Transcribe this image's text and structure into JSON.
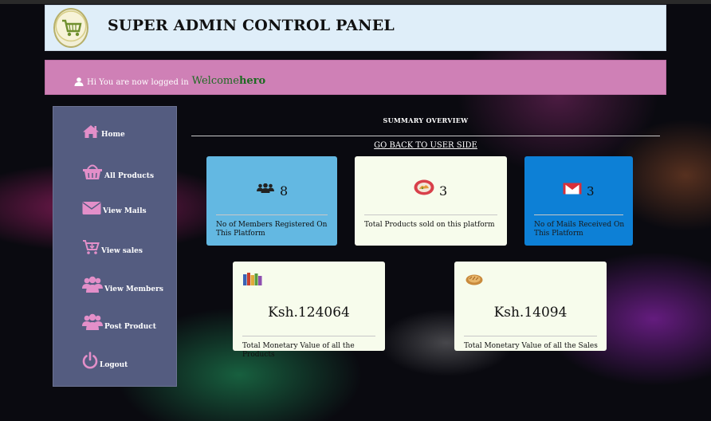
{
  "header": {
    "title": "SUPER ADMIN CONTROL PANEL"
  },
  "welcome": {
    "prefix": "Hi You are now logged in",
    "greeting": "Welcome",
    "username": "hero"
  },
  "sidebar": {
    "items": [
      {
        "label": "Home",
        "icon": "home-icon"
      },
      {
        "label": "All Products",
        "icon": "basket-icon"
      },
      {
        "label": "View Mails",
        "icon": "envelope-icon"
      },
      {
        "label": "View sales",
        "icon": "cart-icon"
      },
      {
        "label": "View Members",
        "icon": "users-icon"
      },
      {
        "label": "Post Product",
        "icon": "users-icon"
      },
      {
        "label": "Logout",
        "icon": "power-icon"
      }
    ]
  },
  "main": {
    "heading": "SUMMARY OVERVIEW",
    "back_link": "GO BACK TO USER SIDE",
    "cards": {
      "members": {
        "value": "8",
        "caption": "No of Members Registered On This Platform",
        "icon": "members-icon"
      },
      "products": {
        "value": "3",
        "caption": "Total Products sold on this platform",
        "icon": "food-icon"
      },
      "mails": {
        "value": "3",
        "caption": "No of Mails Received On This Platform",
        "icon": "mail-icon"
      },
      "products_value": {
        "value": "Ksh.124064",
        "caption": "Total Monetary Value of all the Products",
        "icon": "books-icon"
      },
      "sales_value": {
        "value": "Ksh.14094",
        "caption": "Total Monetary Value of all the Sales",
        "icon": "bread-icon"
      }
    }
  },
  "colors": {
    "header_bg": "#dfeef9",
    "welcome_bg": "#cf80b6",
    "sidebar_bg": "#545c80",
    "icon_pink": "#e38fc9",
    "card_blue": "#63b8e2",
    "card_light": "#f7fcec",
    "card_deep_blue": "#0d80d6"
  }
}
